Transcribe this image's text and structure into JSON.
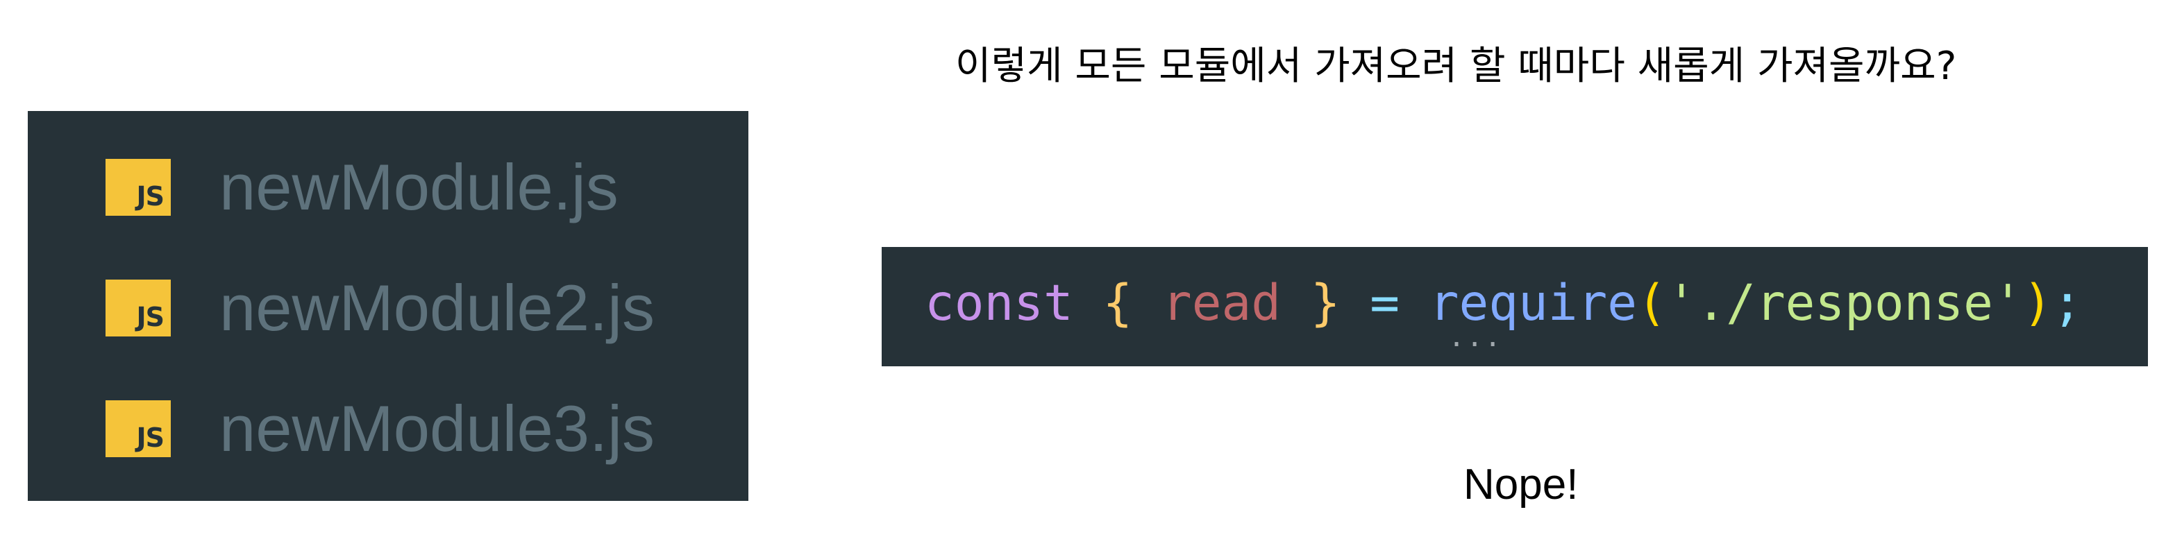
{
  "explorer": {
    "files": [
      {
        "icon": "JS",
        "name": "newModule.js"
      },
      {
        "icon": "JS",
        "name": "newModule2.js"
      },
      {
        "icon": "JS",
        "name": "newModule3.js"
      }
    ]
  },
  "heading": "이렇게 모든 모듈에서 가져오려 할 때마다 새롭게 가져올까요?",
  "code": {
    "keyword": "const",
    "brace_open": "{",
    "variable": "read",
    "brace_close": "}",
    "operator": "=",
    "function": "require",
    "paren_open": "(",
    "string": "'./response'",
    "paren_close": ")",
    "semicolon": ";",
    "hint": "..."
  },
  "answer": "Nope!",
  "colors": {
    "panel_background": "#263238",
    "js_badge": "#f5c43a",
    "file_name": "#5e727c",
    "keyword": "#c792ea",
    "variable": "#c0676a",
    "function": "#82aaff",
    "string": "#c3e88d",
    "brace": "#ffcb6b"
  }
}
